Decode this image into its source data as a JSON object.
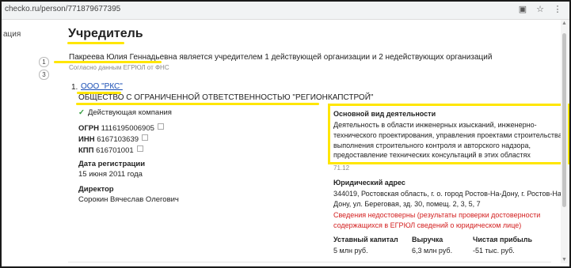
{
  "browser": {
    "url": "checko.ru/person/771879677395"
  },
  "sidebar": {
    "items": [
      {
        "label": "ация"
      },
      {
        "label": "",
        "count": "1"
      },
      {
        "label": "",
        "count": "3"
      }
    ]
  },
  "page": {
    "title": "Учредитель",
    "founder_name": "Пакреева Юлия Геннадьевна",
    "founder_rest": " является учредителем 1 действующей организации и 2 недействующих организаций",
    "source_note": "Согласно данным ЕГРЮЛ от ФНС"
  },
  "org": {
    "index": "1.",
    "short_name": "ООО \"РКС\"",
    "full_name": "ОБЩЕСТВО С ОГРАНИЧЕННОЙ ОТВЕТСТВЕННОСТЬЮ \"РЕГИОНКАПСТРОЙ\"",
    "status": "Действующая компания",
    "ogrn_label": "ОГРН",
    "ogrn": "1116195006905",
    "inn_label": "ИНН",
    "inn": "6167103639",
    "kpp_label": "КПП",
    "kpp": "616701001",
    "reg_date_label": "Дата регистрации",
    "reg_date": "15 июня 2011 года",
    "director_label": "Директор",
    "director": "Сорокин Вячеслав Олегович",
    "activity_label": "Основной вид деятельности",
    "activity": "Деятельность в области инженерных изысканий, инженерно-технического проектирования, управления проектами строительства, выполнения строительного контроля и авторского надзора, предоставление технических консультаций в этих областях",
    "activity_code": "71.12",
    "address_label": "Юридический адрес",
    "address": "344019, Ростовская область, г. о. город Ростов-На-Дону, г. Ростов-На-Дону, ул. Береговая, зд. 30, помещ. 2, 3, 5, 7",
    "address_warning": "Сведения недостоверны (результаты проверки достоверности содержащихся в ЕГРЮЛ сведений о юридическом лице)",
    "capital_label": "Уставный капитал",
    "capital": "5 млн руб.",
    "revenue_label": "Выручка",
    "revenue": "6,3 млн руб.",
    "profit_label": "Чистая прибыль",
    "profit": "-51 тыс. руб."
  },
  "colors": {
    "highlight": "#ffe600",
    "link": "#1a4fb5",
    "warning": "#d32020",
    "active": "#2e9a3a"
  }
}
